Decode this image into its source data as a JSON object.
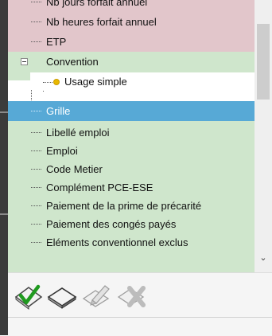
{
  "tree": {
    "items": [
      {
        "label": "Nb jours forfait annuel"
      },
      {
        "label": "Nb heures forfait annuel"
      },
      {
        "label": "ETP"
      },
      {
        "label": "Convention"
      },
      {
        "label": "Usage simple"
      },
      {
        "label": "Grille"
      },
      {
        "label": "Libellé emploi"
      },
      {
        "label": "Emploi"
      },
      {
        "label": "Code Metier"
      },
      {
        "label": "Complément PCE-ESE"
      },
      {
        "label": "Paiement de la prime de précarité"
      },
      {
        "label": "Paiement des congés payés"
      },
      {
        "label": "Eléments conventionnel exclus"
      }
    ],
    "selected_index": 5
  },
  "scrollbar": {
    "down_arrow": "⌄"
  },
  "toolbar": {
    "tools": [
      {
        "icon": "validate-green-check-icon",
        "enabled": true
      },
      {
        "icon": "eraser-icon",
        "enabled": true
      },
      {
        "icon": "edit-pencil-icon",
        "enabled": false
      },
      {
        "icon": "delete-cross-icon",
        "enabled": false
      }
    ]
  },
  "colors": {
    "row_pink": "#e2c6cb",
    "row_green": "#cfe6cc",
    "row_selected": "#57a9d6",
    "bullet": "#e9b800",
    "check_green": "#1f9a1f"
  }
}
